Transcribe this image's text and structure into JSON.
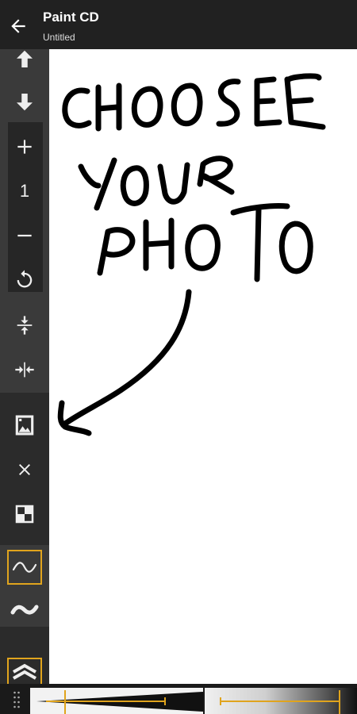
{
  "app": {
    "title": "Paint CD",
    "subtitle": "Untitled"
  },
  "toolbar": {
    "tools": [
      {
        "icon": "arrow-up-icon",
        "label": "Move up"
      },
      {
        "icon": "arrow-down-icon",
        "label": "Move down"
      },
      {
        "icon": "plus-icon",
        "label": "Zoom in"
      },
      {
        "icon": "zoom-level",
        "value": "1"
      },
      {
        "icon": "minus-icon",
        "label": "Zoom out"
      },
      {
        "icon": "reset-icon",
        "label": "Reset zoom"
      },
      {
        "icon": "compress-vertical-icon",
        "label": "Fit vertical"
      },
      {
        "icon": "compress-horizontal-icon",
        "label": "Fit horizontal"
      },
      {
        "icon": "image-icon",
        "label": "Choose photo"
      },
      {
        "icon": "close-icon",
        "label": "Remove photo"
      },
      {
        "icon": "checker-icon",
        "label": "Transparency"
      },
      {
        "icon": "smooth-stroke-icon",
        "label": "Smooth stroke",
        "selected": true
      },
      {
        "icon": "wave-stroke-icon",
        "label": "Wave stroke"
      },
      {
        "icon": "chevron-up-icon",
        "label": "Expand",
        "selected": true
      }
    ],
    "zoom_value": "1"
  },
  "colors": {
    "appbar": "#212121",
    "sidebar": "#3a3a3a",
    "accent": "#e0a41d",
    "canvas": "#ffffff",
    "ink": "#000000"
  },
  "canvas": {
    "drawing": "handwritten text with an arrow pointing to the photo button",
    "handwritten_lines": [
      "CHOOSE",
      "YOUR",
      "PHOTO"
    ]
  }
}
